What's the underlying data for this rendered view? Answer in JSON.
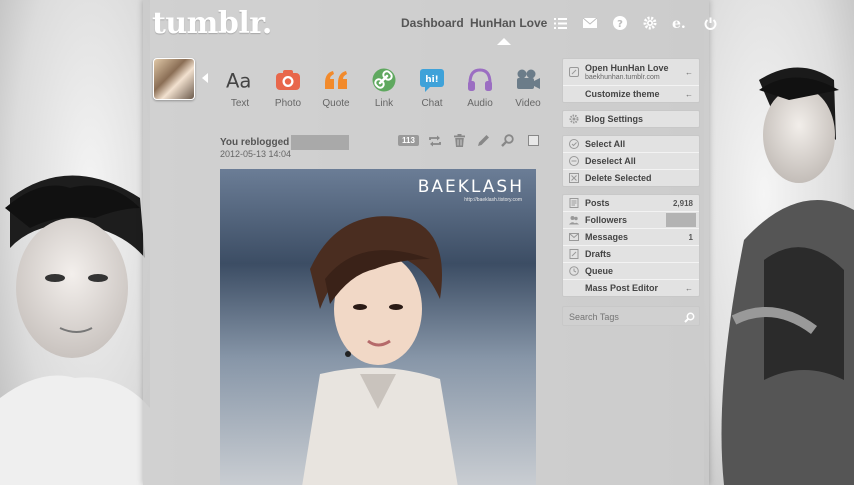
{
  "header": {
    "logo": "tumblr.",
    "nav": {
      "dashboard": "Dashboard",
      "blog": "HunHan Love"
    },
    "icons": [
      "list-icon",
      "mail-icon",
      "help-icon",
      "gear-icon",
      "blog-e-icon",
      "power-icon"
    ]
  },
  "post_types": [
    {
      "label": "Text",
      "icon": "text-icon",
      "color": "#444444"
    },
    {
      "label": "Photo",
      "icon": "camera-icon",
      "color": "#e8674b"
    },
    {
      "label": "Quote",
      "icon": "quote-icon",
      "color": "#f28a2b"
    },
    {
      "label": "Link",
      "icon": "link-icon",
      "color": "#5fa85f"
    },
    {
      "label": "Chat",
      "icon": "chat-icon",
      "color": "#3fa2d9"
    },
    {
      "label": "Audio",
      "icon": "headphones-icon",
      "color": "#9b6ec2"
    },
    {
      "label": "Video",
      "icon": "video-icon",
      "color": "#6b7c89"
    }
  ],
  "post": {
    "reblog_prefix": "You reblogged",
    "date": "2012-05-13 14:04",
    "notes": "113",
    "watermark": "BAEKLASH",
    "watermark_url": "http://baeklash.tistory.com"
  },
  "sidebar": {
    "open_blog": "Open HunHan Love",
    "blog_url": "baekhunhan.tumblr.com",
    "customize": "Customize theme",
    "blog_settings": "Blog Settings",
    "select_all": "Select All",
    "deselect_all": "Deselect All",
    "delete_selected": "Delete Selected",
    "posts": "Posts",
    "posts_count": "2,918",
    "followers": "Followers",
    "messages": "Messages",
    "messages_count": "1",
    "drafts": "Drafts",
    "queue": "Queue",
    "mass_editor": "Mass Post Editor",
    "search_placeholder": "Search Tags"
  }
}
